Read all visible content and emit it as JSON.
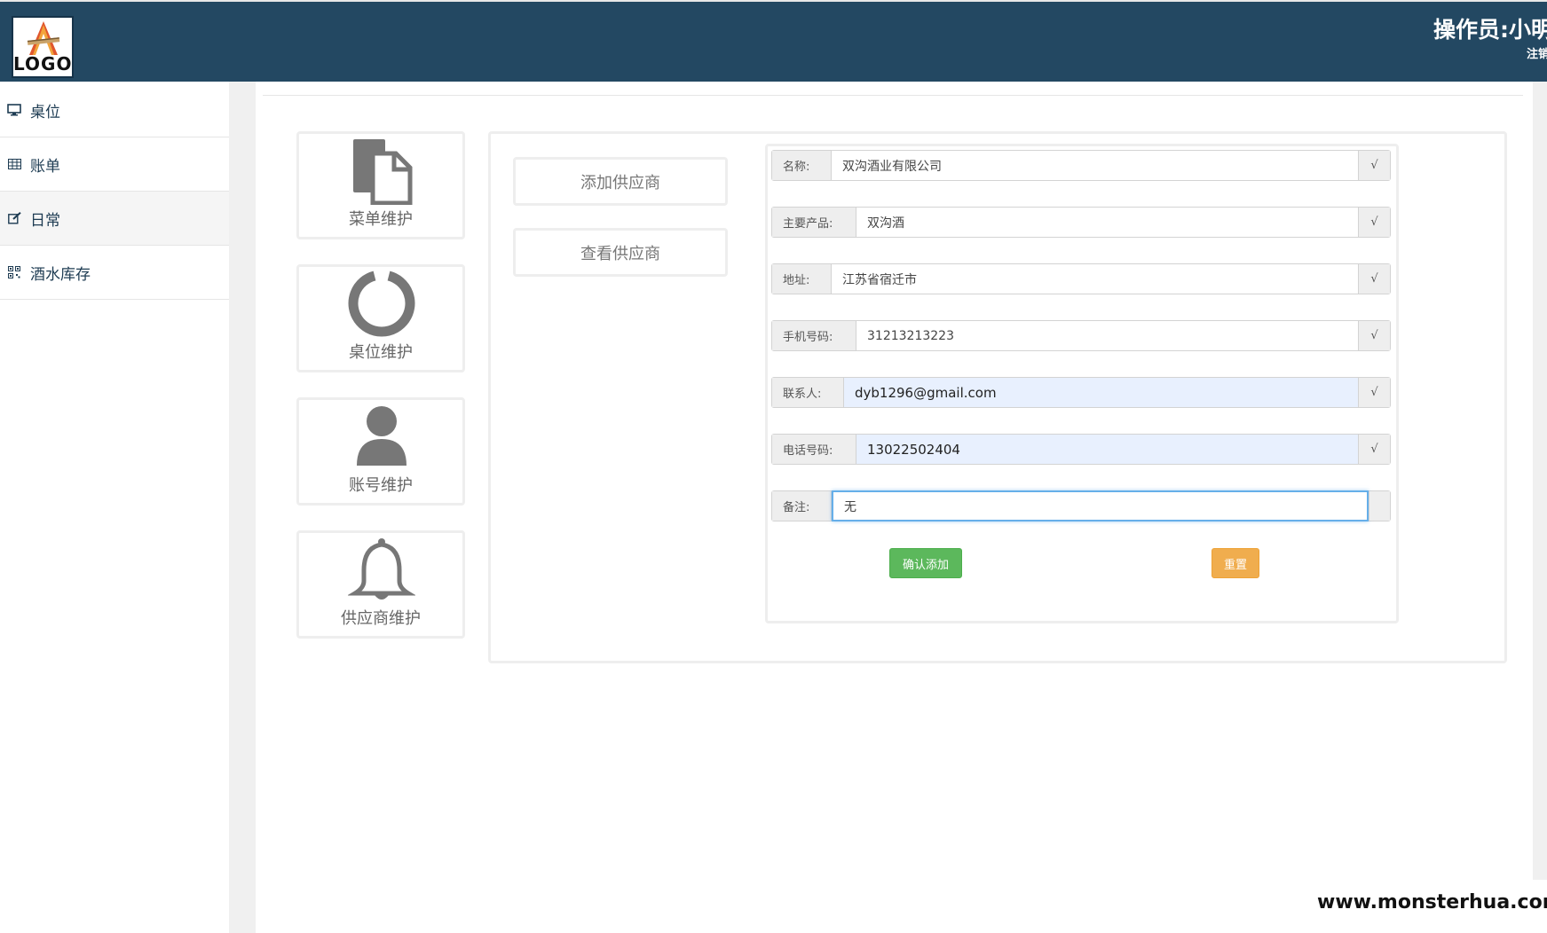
{
  "header": {
    "logo_text": "LOGO",
    "operator": "操作员:小明",
    "logout": "注销"
  },
  "sidebar": {
    "items": [
      {
        "label": "桌位",
        "icon": "monitor-icon"
      },
      {
        "label": "账单",
        "icon": "table-icon"
      },
      {
        "label": "日常",
        "icon": "edit-icon"
      },
      {
        "label": "酒水库存",
        "icon": "qrcode-icon"
      }
    ],
    "active_index": 2
  },
  "tiles": [
    {
      "label": "菜单维护",
      "icon": "files-icon"
    },
    {
      "label": "桌位维护",
      "icon": "ring-icon"
    },
    {
      "label": "账号维护",
      "icon": "user-icon"
    },
    {
      "label": "供应商维护",
      "icon": "bell-icon"
    }
  ],
  "submenu": [
    {
      "label": "添加供应商"
    },
    {
      "label": "查看供应商"
    }
  ],
  "form": {
    "fields": [
      {
        "label": "名称:",
        "value": "双沟酒业有限公司",
        "check": "√"
      },
      {
        "label": "主要产品:",
        "value": "双沟酒",
        "check": "√"
      },
      {
        "label": "地址:",
        "value": "江苏省宿迁市",
        "check": "√"
      },
      {
        "label": "手机号码:",
        "value": "31213213223",
        "check": "√"
      },
      {
        "label": "联系人:",
        "value": "dyb1296@gmail.com",
        "check": "√"
      },
      {
        "label": "电话号码:",
        "value": "13022502404",
        "check": "√"
      },
      {
        "label": "备注:",
        "value": "无",
        "check": ""
      }
    ],
    "confirm_label": "确认添加",
    "reset_label": "重置"
  },
  "colors": {
    "header_bg": "#234862",
    "confirm": "#5cb85c",
    "reset": "#f0ad4e",
    "autofill": "#e8f0fe"
  },
  "watermark": "www.monsterhua.com"
}
